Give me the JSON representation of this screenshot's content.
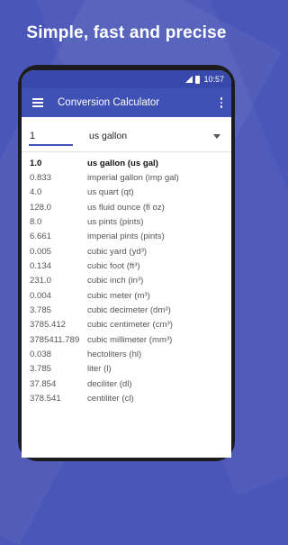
{
  "headline": "Simple, fast and precise",
  "status_bar": {
    "time": "10:57",
    "icons": [
      "signal-icon",
      "battery-icon"
    ]
  },
  "app_bar": {
    "title": "Conversion Calculator",
    "menu_icon": "hamburger-icon",
    "overflow_icon": "more-vert-icon"
  },
  "input": {
    "value": "1"
  },
  "unit_select": {
    "selected": "us gallon"
  },
  "colors": {
    "background": "#4a56b8",
    "app_bar": "#3f51b5",
    "status_bar": "#3949ab",
    "accent": "#3f51b5"
  },
  "results": [
    {
      "value": "1.0",
      "unit": "us gallon (us gal)"
    },
    {
      "value": "0.833",
      "unit": "imperial gallon (imp gal)"
    },
    {
      "value": "4.0",
      "unit": "us quart (qt)"
    },
    {
      "value": "128.0",
      "unit": "us fluid ounce (fl oz)"
    },
    {
      "value": "8.0",
      "unit": "us pints (pints)"
    },
    {
      "value": "6.661",
      "unit": "imperial pints (pints)"
    },
    {
      "value": "0.005",
      "unit": "cubic yard (yd³)"
    },
    {
      "value": "0.134",
      "unit": "cubic foot (ft³)"
    },
    {
      "value": "231.0",
      "unit": "cubic inch (in³)"
    },
    {
      "value": "0.004",
      "unit": "cubic meter (m³)"
    },
    {
      "value": "3.785",
      "unit": "cubic decimeter (dm³)"
    },
    {
      "value": "3785.412",
      "unit": "cubic centimeter (cm³)"
    },
    {
      "value": "3785411.789",
      "unit": "cubic millimeter (mm³)"
    },
    {
      "value": "0.038",
      "unit": "hectoliters (hl)"
    },
    {
      "value": "3.785",
      "unit": "liter (l)"
    },
    {
      "value": "37.854",
      "unit": "deciliter (dl)"
    },
    {
      "value": "378.541",
      "unit": "centiliter (cl)"
    }
  ]
}
